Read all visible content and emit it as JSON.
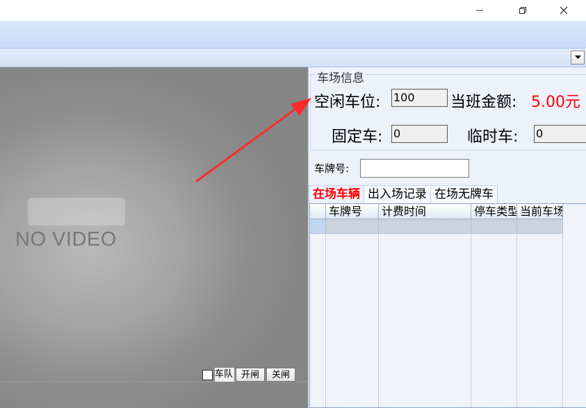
{
  "window": {
    "controls": [
      "minimize-icon",
      "restore-icon",
      "close-icon"
    ]
  },
  "video": {
    "no_video_text": "NO VIDEO",
    "queue_label": "车队",
    "open_gate_label": "开闸",
    "close_gate_label": "关闸"
  },
  "lot_info": {
    "group_title": "车场信息",
    "free_spaces_label": "空闲车位:",
    "free_spaces_value": "100",
    "shift_amount_label": "当班金额:",
    "shift_amount_value": "5.00元",
    "fixed_car_label": "固定车:",
    "fixed_car_value": "0",
    "temp_car_label": "临时车:",
    "temp_car_value": "0"
  },
  "search": {
    "plate_label": "车牌号:",
    "plate_value": ""
  },
  "tabs": [
    {
      "label": "在场车辆",
      "active": true
    },
    {
      "label": "出入场记录",
      "active": false
    },
    {
      "label": "在场无牌车",
      "active": false
    }
  ],
  "table": {
    "columns": [
      "车牌号",
      "计费时间",
      "停车类型",
      "当前车场"
    ]
  },
  "colors": {
    "accent_red": "#ff0000",
    "ribbon_blue": "#c6dbf6"
  }
}
